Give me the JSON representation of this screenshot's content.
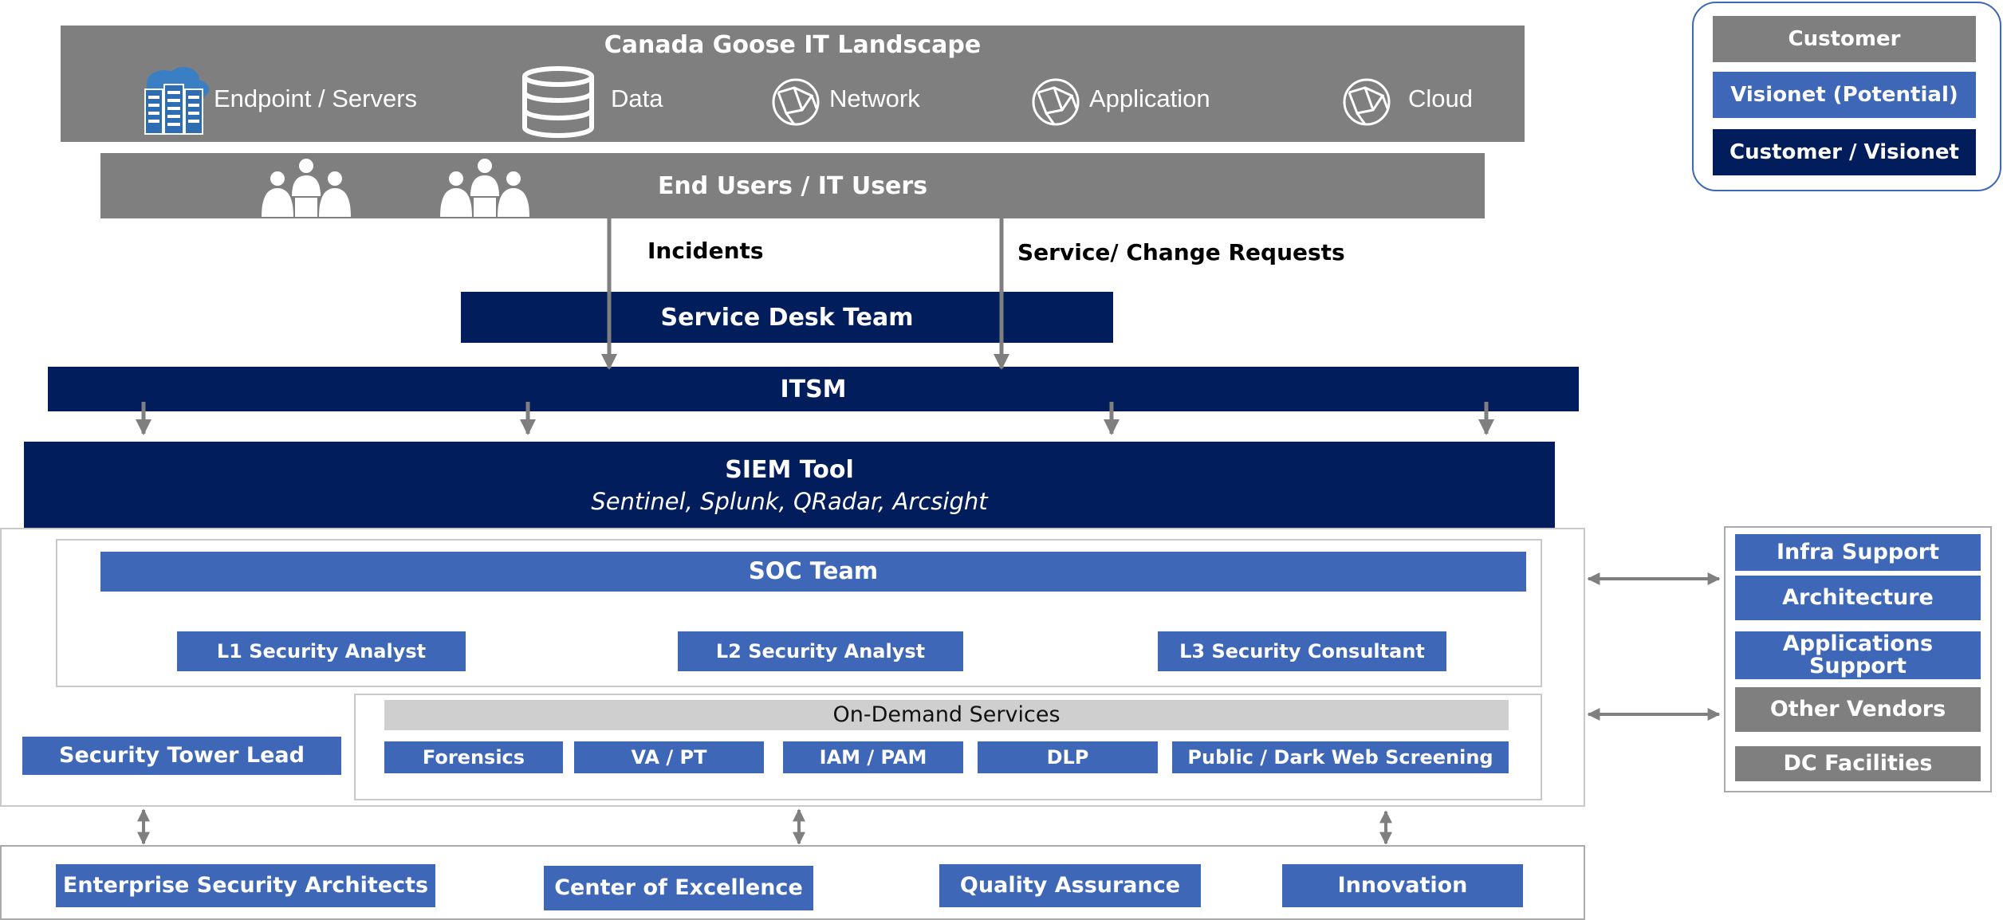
{
  "top": {
    "title": "Canada Goose IT Landscape",
    "items": [
      {
        "label": "Endpoint / Servers",
        "icon": "server-cloud-icon"
      },
      {
        "label": "Data",
        "icon": "database-icon"
      },
      {
        "label": "Network",
        "icon": "globe-icon"
      },
      {
        "label": "Application",
        "icon": "globe-icon"
      },
      {
        "label": "Cloud",
        "icon": "globe-icon"
      }
    ]
  },
  "end_users": {
    "title": "End Users / IT Users",
    "icon": "user-group-icon"
  },
  "flows": {
    "incidents": "Incidents",
    "requests": "Service/ Change Requests"
  },
  "service_desk": "Service Desk Team",
  "itsm": "ITSM",
  "siem": {
    "title": "SIEM Tool",
    "subtitle": "Sentinel, Splunk, QRadar, Arcsight"
  },
  "soc": {
    "title": "SOC Team",
    "roles": [
      "L1 Security Analyst",
      "L2 Security Analyst",
      "L3 Security Consultant"
    ]
  },
  "on_demand": {
    "title": "On-Demand Services",
    "services": [
      "Forensics",
      "VA / PT",
      "IAM / PAM",
      "DLP",
      "Public / Dark Web Screening"
    ]
  },
  "tower_lead": "Security Tower Lead",
  "bottom": [
    "Enterprise Security Architects",
    "Center of Excellence",
    "Quality Assurance",
    "Innovation"
  ],
  "legend": [
    "Customer",
    "Visionet (Potential)",
    "Customer / Visionet"
  ],
  "support": [
    "Infra Support",
    "Architecture",
    "Applications Support",
    "Other Vendors",
    "DC Facilities"
  ],
  "colors": {
    "customer": "#7f7f7f",
    "visionet_potential": "#3e67b8",
    "customer_visionet": "#021d5b"
  }
}
